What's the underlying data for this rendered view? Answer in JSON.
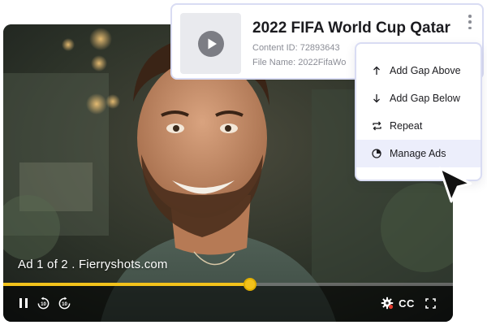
{
  "player": {
    "ad_label": "Ad 1 of 2 .  Fierryshots.com",
    "progress_fraction": 0.548,
    "accent_color": "#f2c21b",
    "controls": {
      "pause_icon": "pause-icon",
      "rewind_icon": "rewind-10-icon",
      "forward_icon": "forward-10-icon",
      "settings_icon": "settings-gear-icon",
      "cc_label": "CC",
      "fullscreen_icon": "fullscreen-icon"
    }
  },
  "card": {
    "title": "2022 FIFA World Cup Qatar",
    "content_id": "Content ID: 72893643",
    "file_name": "File Name: 2022FifaWo",
    "thumbnail_icon": "play-circle-icon",
    "menu_icon": "kebab-menu-icon"
  },
  "menu": {
    "items": [
      {
        "label": "Add Gap Above",
        "icon": "arrow-up-icon"
      },
      {
        "label": "Add Gap Below",
        "icon": "arrow-down-icon"
      },
      {
        "label": "Repeat",
        "icon": "repeat-icon"
      },
      {
        "label": "Manage Ads",
        "icon": "pie-chart-icon"
      }
    ],
    "active_item": "Manage Ads",
    "active_color": "#eceefb"
  }
}
